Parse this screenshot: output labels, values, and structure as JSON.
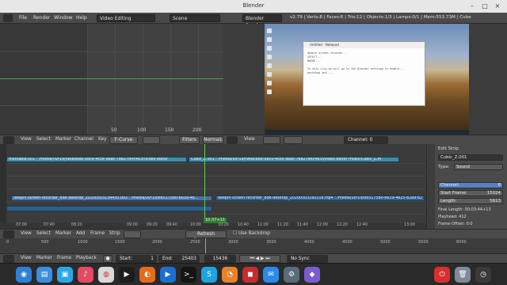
{
  "window": {
    "title": "Blender"
  },
  "menubar": {
    "menus": [
      "File",
      "Render",
      "Window",
      "Help"
    ],
    "screen_layout": "Video Editing",
    "scene": "Scene",
    "render_engine": "Blender Render",
    "stats": "v2.79 | Verts:8 | Faces:6 | Tris:12 | Objects:1/3 | Lamps:0/1 | Mem:553.73M | Cube"
  },
  "graph_editor": {
    "axis_ticks": [
      "50",
      "100",
      "150",
      "200"
    ],
    "header": {
      "menus": [
        "View",
        "Select",
        "Marker",
        "Channel",
        "Key"
      ],
      "mode": "F-Curve",
      "filters_label": "Filters",
      "normalize_label": "Normalize"
    }
  },
  "preview": {
    "notepad_title": "Untitled - Notepad",
    "notepad_text": "deepin-screen-recorder...\nSELECT...\nWHERE...\n\nIn this clip we will go to the Blender settings to enable...\nworkshop and ...",
    "header": {
      "menus": [
        "View",
        "View"
      ],
      "channel_label": "Channel:",
      "channel_value": "0"
    }
  },
  "sequencer": {
    "strips": [
      {
        "name": "movtable.001 : /media/uvr19/f96bcbeb-98c9-4cce-9bac-7bb27d4c463f/video editor",
        "color": "teal",
        "lane": 0
      },
      {
        "name": "Cubic_Z.001 : /media/uvr19/f96bcbeb-98c9-4cce-9bac-7bb27d4c463f/video editor music/Cubic_Z.m",
        "color": "teal",
        "lane": 0
      },
      {
        "name": "deepin-screen-recorder_dde-desktop_20200503134430.002 : /media/uvr19/b6517580-6639-4e...",
        "color": "blue",
        "lane": 2
      },
      {
        "name": "deepin-screen-recorder_dde-desktop_20200503160318.mp4 : /media/uvr19/b6517580-6639-4e25-82a9-d2",
        "color": "dblue",
        "lane": 1
      }
    ],
    "current_frame_badge": "10:37+11",
    "time_ticks": [
      "07:00",
      "07:40",
      "08:20",
      "09:00",
      "09:20",
      "09:40",
      "10:00",
      "10:20",
      "10:40",
      "11:00",
      "11:20",
      "11:40",
      "12:00",
      "12:20",
      "12:40",
      "13:00"
    ],
    "header": {
      "menus": [
        "View",
        "Select",
        "Marker",
        "Add",
        "Frame",
        "Strip"
      ],
      "refresh_label": "Refresh Sequencer",
      "backdrop_label": "Use Backdrop"
    }
  },
  "edit_strip": {
    "panel_title": "Edit Strip",
    "name_value": "Cubic_Z.001",
    "type_label": "Type:",
    "type_value": "Sound",
    "channel_label": "Channel:",
    "channel_value": "6",
    "start_frame_label": "Start Frame:",
    "start_frame_value": "15024",
    "length_label": "Length:",
    "length_value": "5613",
    "final_length": "Final Length: 00:03:44+13",
    "playhead": "Playhead: 412",
    "frame_offset": "Frame Offset: 0:0"
  },
  "timeline": {
    "ticks": [
      "0",
      "500",
      "1000",
      "1500",
      "2000",
      "2500",
      "3000",
      "3500",
      "4000",
      "4500",
      "5000",
      "5500",
      "6000"
    ],
    "header": {
      "menus": [
        "View",
        "Marker",
        "Frame",
        "Playback"
      ],
      "start_label": "Start:",
      "start_value": "1",
      "end_label": "End:",
      "end_value": "25403",
      "current_frame": "15436",
      "sync_value": "No Sync"
    }
  },
  "dock": {
    "icons": [
      "deepin-launcher-icon",
      "files-icon",
      "app-store-icon",
      "music-icon",
      "chrome-icon",
      "video-icon",
      "firefox-icon",
      "media-player-icon",
      "terminal-icon",
      "skype-icon",
      "blender-icon",
      "screen-recorder-icon",
      "messenger-icon",
      "settings-icon",
      "dock-icon-9",
      "shutdown-icon",
      "trash-icon",
      "clock-icon"
    ]
  }
}
